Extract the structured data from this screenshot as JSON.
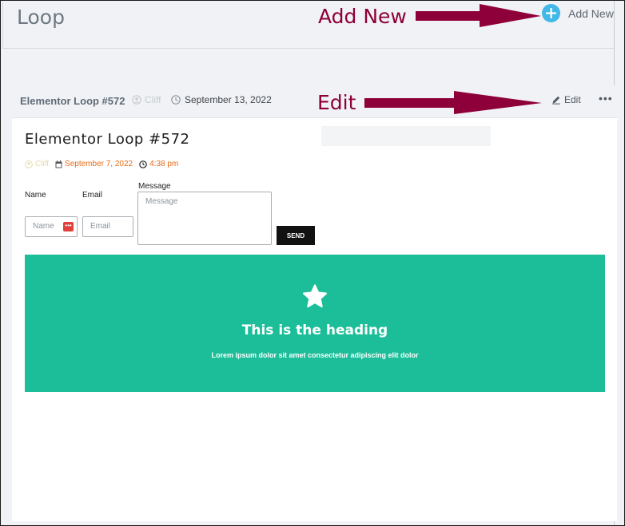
{
  "page": {
    "title": "Loop"
  },
  "annotations": {
    "add_new": "Add New",
    "edit": "Edit"
  },
  "header": {
    "add_new_label": "Add New",
    "add_icon": "plus-circle-icon",
    "accent": "#42b8e8"
  },
  "card": {
    "title": "Elementor Loop #572",
    "author": "Cliff",
    "date": "September 13, 2022",
    "edit_label": "Edit",
    "more_label": "•••"
  },
  "preview": {
    "post_title": "Elementor Loop #572",
    "author": "Cliff",
    "date": "September 7, 2022",
    "time": "4:38 pm",
    "form": {
      "name_label": "Name",
      "email_label": "Email",
      "message_label": "Message",
      "name_placeholder": "Name",
      "email_placeholder": "Email",
      "message_placeholder": "Message",
      "send_label": "SEND"
    },
    "hero": {
      "heading": "This is the heading",
      "text": "Lorem ipsum dolor sit amet consectetur adipiscing elit dolor",
      "background": "#1cbe99",
      "icon": "star-icon"
    }
  }
}
